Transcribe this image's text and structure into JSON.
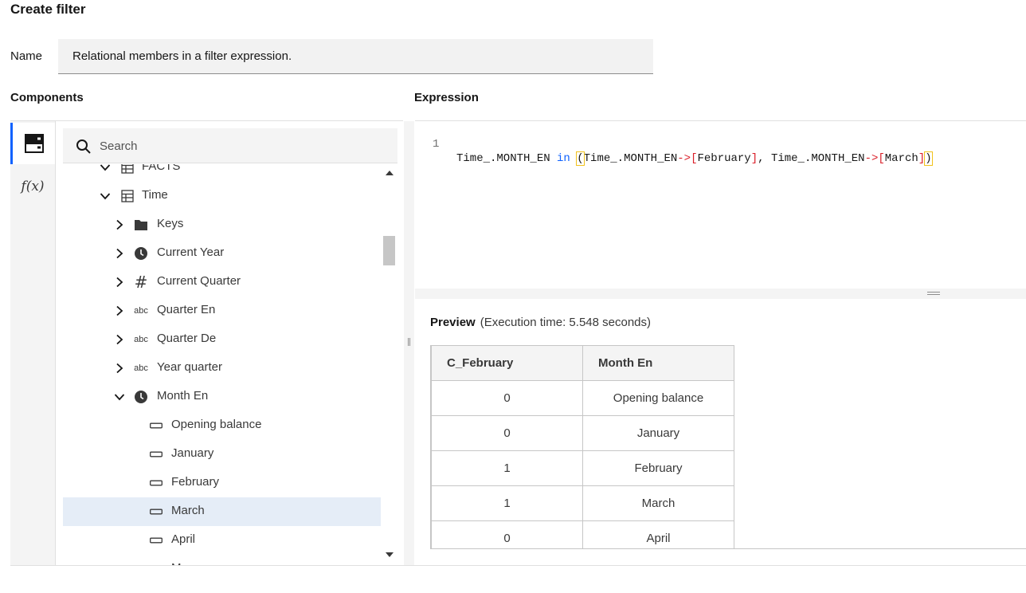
{
  "dialog": {
    "title": "Create filter"
  },
  "name_field": {
    "label": "Name",
    "value": "Relational members in a filter expression."
  },
  "components": {
    "label": "Components",
    "search_placeholder": "Search",
    "tree": [
      {
        "label": "FACTS",
        "icon": "table-icon",
        "level": 0,
        "expanded": true
      },
      {
        "label": "Time",
        "icon": "table-icon",
        "level": 0,
        "expanded": true
      },
      {
        "label": "Keys",
        "icon": "folder-icon",
        "level": 1,
        "expanded": false
      },
      {
        "label": "Current Year",
        "icon": "clock-icon",
        "level": 1,
        "expanded": false
      },
      {
        "label": "Current Quarter",
        "icon": "hash-icon",
        "level": 1,
        "expanded": false
      },
      {
        "label": "Quarter En",
        "icon": "abc-icon",
        "level": 1,
        "expanded": false
      },
      {
        "label": "Quarter De",
        "icon": "abc-icon",
        "level": 1,
        "expanded": false
      },
      {
        "label": "Year quarter",
        "icon": "abc-icon",
        "level": 1,
        "expanded": false
      },
      {
        "label": "Month En",
        "icon": "clock-icon",
        "level": 1,
        "expanded": true
      },
      {
        "label": "Opening balance",
        "icon": "member-icon",
        "level": 2
      },
      {
        "label": "January",
        "icon": "member-icon",
        "level": 2
      },
      {
        "label": "February",
        "icon": "member-icon",
        "level": 2
      },
      {
        "label": "March",
        "icon": "member-icon",
        "level": 2,
        "selected": true
      },
      {
        "label": "April",
        "icon": "member-icon",
        "level": 2
      },
      {
        "label": "May",
        "icon": "member-icon",
        "level": 2
      }
    ]
  },
  "expression": {
    "label": "Expression",
    "line_number": "1",
    "tokens": {
      "t1": "Time_.MONTH_EN ",
      "kw": "in",
      "sp": " ",
      "open": "(",
      "t2": "Time_.MONTH_EN",
      "arrow1": "->",
      "b1o": "[",
      "m1": "February",
      "b1c": "]",
      "sep": ", ",
      "t3": "Time_.MONTH_EN",
      "arrow2": "->",
      "b2o": "[",
      "m2": "March",
      "b2c": "]",
      "close": ")"
    }
  },
  "preview": {
    "label": "Preview",
    "exec_time": "(Execution time: 5.548 seconds)",
    "columns": [
      "C_February",
      "Month En"
    ],
    "rows": [
      [
        "0",
        "Opening balance"
      ],
      [
        "0",
        "January"
      ],
      [
        "1",
        "February"
      ],
      [
        "1",
        "March"
      ],
      [
        "0",
        "April"
      ]
    ]
  },
  "colors": {
    "accent": "#0f62fe",
    "selected_row": "#e5edf7",
    "keyword": "#0f62fe",
    "operator": "#da1e28"
  }
}
